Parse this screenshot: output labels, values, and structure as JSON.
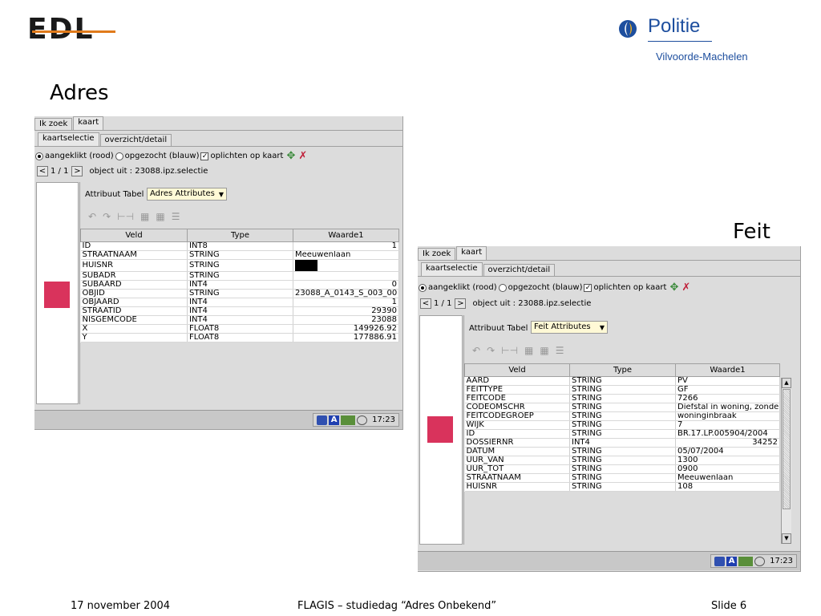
{
  "header": {
    "edl_logo_text": "EDL",
    "politie_name": "Politie",
    "politie_sub": "Vilvoorde-Machelen"
  },
  "titles": {
    "adres": "Adres",
    "feit": "Feit"
  },
  "colors": {
    "swatch": "#d9335c",
    "politie_blue": "#1d4e9e",
    "edl_orange": "#e07a1a"
  },
  "window_left": {
    "outer_tabs": [
      "Ik zoek",
      "kaart"
    ],
    "inner_tabs": [
      "kaartselectie",
      "overzicht/detail"
    ],
    "radio_1": "aangeklikt (rood)",
    "radio_2": "opgezocht (blauw)",
    "checkbox": "oplichten op kaart",
    "nav_prev": "<",
    "page": "1 / 1",
    "nav_next": ">",
    "object_text": "object uit : 23088.ipz.selectie",
    "attr_label": "Attribuut Tabel",
    "attr_select": "Adres Attributes",
    "columns": [
      "Veld",
      "Type",
      "Waarde1"
    ],
    "rows": [
      [
        "ID",
        "INT8",
        "1"
      ],
      [
        "STRAATNAAM",
        "STRING",
        "Meeuwenlaan"
      ],
      [
        "HUISNR",
        "STRING",
        ""
      ],
      [
        "SUBADR",
        "STRING",
        ""
      ],
      [
        "SUBAARD",
        "INT4",
        "0"
      ],
      [
        "OBJID",
        "STRING",
        "23088_A_0143_S_003_00"
      ],
      [
        "OBJAARD",
        "INT4",
        "1"
      ],
      [
        "STRAATID",
        "INT4",
        "29390"
      ],
      [
        "NISGEMCODE",
        "INT4",
        "23088"
      ],
      [
        "X",
        "FLOAT8",
        "149926.92"
      ],
      [
        "Y",
        "FLOAT8",
        "177886.91"
      ]
    ],
    "clock": "17:23"
  },
  "window_right": {
    "outer_tabs": [
      "Ik zoek",
      "kaart"
    ],
    "inner_tabs": [
      "kaartselectie",
      "overzicht/detail"
    ],
    "radio_1": "aangeklikt (rood)",
    "radio_2": "opgezocht (blauw)",
    "checkbox": "oplichten op kaart",
    "nav_prev": "<",
    "page": "1 / 1",
    "nav_next": ">",
    "object_text": "object uit : 23088.ipz.selectie",
    "attr_label": "Attribuut Tabel",
    "attr_select": "Feit Attributes",
    "columns": [
      "Veld",
      "Type",
      "Waarde1"
    ],
    "rows": [
      [
        "AARD",
        "STRING",
        "PV"
      ],
      [
        "FEITTYPE",
        "STRING",
        "GF"
      ],
      [
        "FEITCODE",
        "STRING",
        "7266"
      ],
      [
        "CODEOMSCHR",
        "STRING",
        "Diefstal in woning, zonder"
      ],
      [
        "FEITCODEGROEP",
        "STRING",
        "woninginbraak"
      ],
      [
        "WIJK",
        "STRING",
        "7"
      ],
      [
        "ID",
        "STRING",
        "BR.17.LP.005904/2004"
      ],
      [
        "DOSSIERNR",
        "INT4",
        "34252"
      ],
      [
        "DATUM",
        "STRING",
        "05/07/2004"
      ],
      [
        "UUR_VAN",
        "STRING",
        "1300"
      ],
      [
        "UUR_TOT",
        "STRING",
        "0900"
      ],
      [
        "STRAATNAAM",
        "STRING",
        "Meeuwenlaan"
      ],
      [
        "HUISNR",
        "STRING",
        "108"
      ]
    ],
    "clock": "17:23"
  },
  "footer": {
    "date": "17 november 2004",
    "center": "FLAGIS – studiedag “Adres Onbekend”",
    "slide": "Slide 6"
  }
}
